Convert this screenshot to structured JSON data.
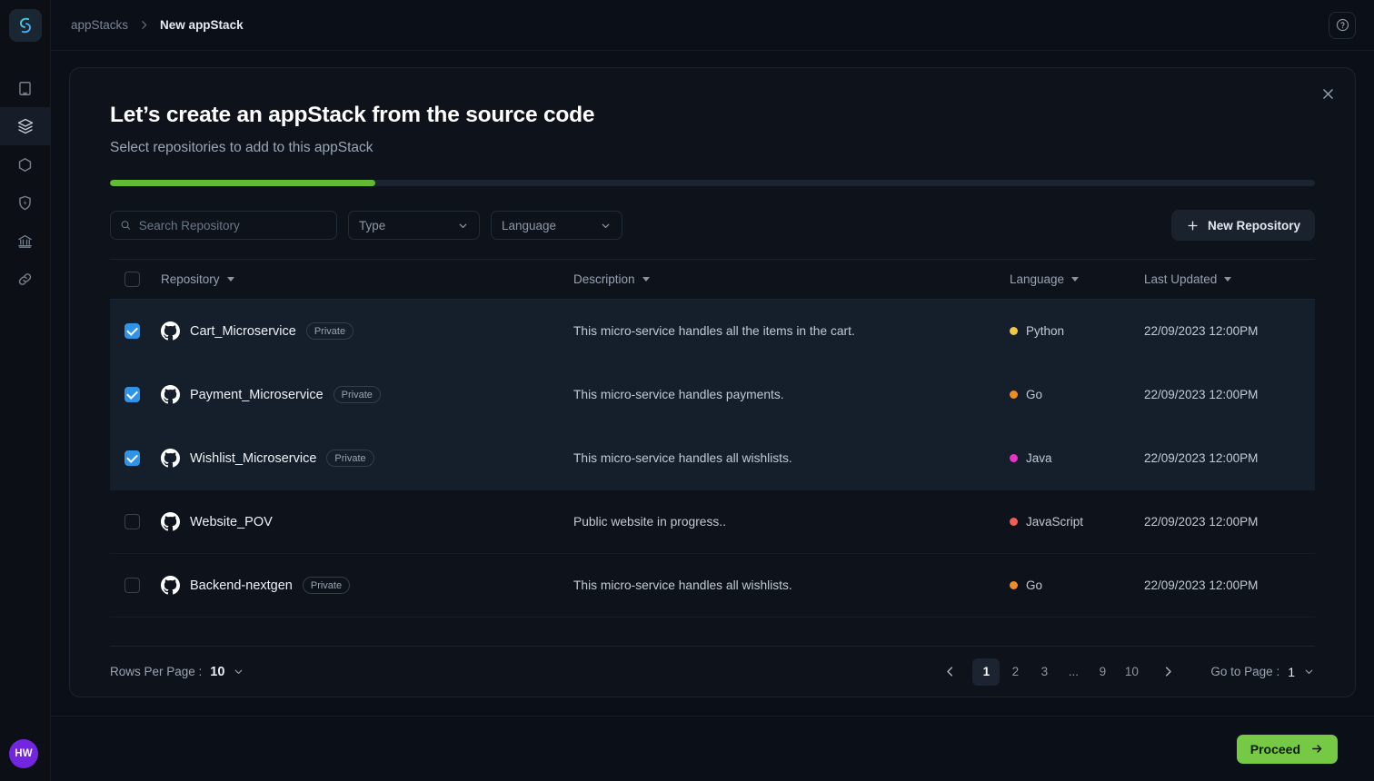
{
  "sidebar": {
    "logo_name": "app-logo",
    "avatar_initials": "HW",
    "items": [
      {
        "name": "book-icon",
        "active": false
      },
      {
        "name": "layers-icon",
        "active": true
      },
      {
        "name": "hexagon-icon",
        "active": false
      },
      {
        "name": "shield-bolt-icon",
        "active": false
      },
      {
        "name": "bank-icon",
        "active": false
      },
      {
        "name": "link-icon",
        "active": false
      }
    ]
  },
  "topbar": {
    "breadcrumb_root": "appStacks",
    "breadcrumb_current": "New appStack",
    "help_label": "?"
  },
  "wizard": {
    "title": "Let’s create an appStack from the source code",
    "subtitle": "Select repositories to add to this appStack",
    "progress_percent": 22,
    "progress_color": "#61b934"
  },
  "filters": {
    "search_placeholder": "Search Repository",
    "search_value": "",
    "type_label": "Type",
    "language_label": "Language",
    "new_repository_label": "New Repository"
  },
  "table": {
    "columns": {
      "repository": "Repository",
      "description": "Description",
      "language": "Language",
      "last_updated": "Last Updated"
    },
    "select_all_checked": false,
    "rows": [
      {
        "checked": true,
        "name": "Cart_Microservice",
        "badge": "Private",
        "description": "This micro-service handles all the items in the cart.",
        "language": "Python",
        "language_color": "#f2c744",
        "last_updated": "22/09/2023 12:00PM"
      },
      {
        "checked": true,
        "name": "Payment_Microservice",
        "badge": "Private",
        "description": "This micro-service handles payments.",
        "language": "Go",
        "language_color": "#f08c28",
        "last_updated": "22/09/2023 12:00PM"
      },
      {
        "checked": true,
        "name": "Wishlist_Microservice",
        "badge": "Private",
        "description": "This micro-service handles all wishlists.",
        "language": "Java",
        "language_color": "#e832c8",
        "last_updated": "22/09/2023 12:00PM"
      },
      {
        "checked": false,
        "name": "Website_POV",
        "badge": "",
        "description": "Public website in progress..",
        "language": "JavaScript",
        "language_color": "#ef5d53",
        "last_updated": "22/09/2023 12:00PM"
      },
      {
        "checked": false,
        "name": "Backend-nextgen",
        "badge": "Private",
        "description": "This micro-service handles all wishlists.",
        "language": "Go",
        "language_color": "#f08c28",
        "last_updated": "22/09/2023 12:00PM"
      }
    ]
  },
  "pagination": {
    "rows_per_page_label": "Rows Per Page :",
    "rows_per_page_value": "10",
    "pages": [
      "1",
      "2",
      "3",
      "...",
      "9",
      "10"
    ],
    "current_page": "1",
    "goto_label": "Go to Page :",
    "goto_value": "1"
  },
  "footer": {
    "proceed_label": "Proceed",
    "proceed_color": "#76c945"
  }
}
